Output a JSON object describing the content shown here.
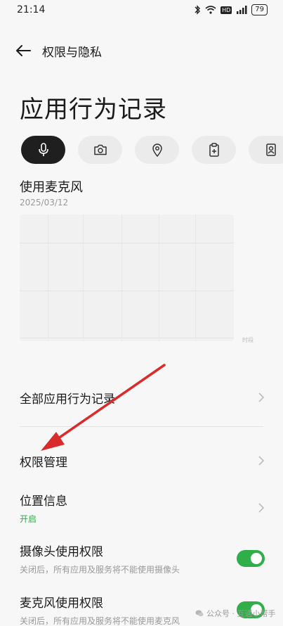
{
  "status_bar": {
    "time": "21:14",
    "battery": "79",
    "network_badge": "HD",
    "icons": [
      "bluetooth-icon",
      "wifi-icon",
      "signal-icon",
      "battery-icon"
    ]
  },
  "header": {
    "back_icon": "arrow-left-icon",
    "title": "权限与隐私"
  },
  "page": {
    "title": "应用行为记录"
  },
  "chips": [
    {
      "icon": "microphone-icon",
      "active": true
    },
    {
      "icon": "camera-icon",
      "active": false
    },
    {
      "icon": "location-icon",
      "active": false
    },
    {
      "icon": "clipboard-icon",
      "active": false
    },
    {
      "icon": "contacts-icon",
      "active": false
    }
  ],
  "usage": {
    "title": "使用麦克风",
    "date": "2025/03/12",
    "chart_unit": "时段"
  },
  "menu": {
    "all_records": "全部应用行为记录",
    "permission_management": "权限管理",
    "location_info": "位置信息",
    "location_status": "开启",
    "camera_permission": "摄像头使用权限",
    "camera_desc": "关闭后，所有应用及服务将不能使用摄像头",
    "camera_enabled": true,
    "mic_permission": "麦克风使用权限",
    "mic_desc": "关闭后，所有应用及服务将不能使用麦克风",
    "mic_enabled": true
  },
  "watermark": "公众号 · 互通小帮手",
  "colors": {
    "accent_green": "#2fae4a",
    "arrow_red": "#d92b2b",
    "chip_active": "#1f1f1f"
  }
}
